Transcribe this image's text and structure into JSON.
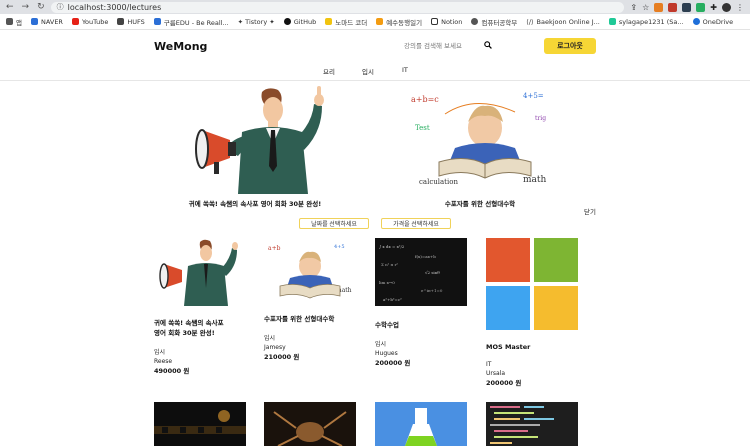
{
  "browser": {
    "url": "localhost:3000/lectures",
    "bookmarks": [
      "앱",
      "NAVER",
      "YouTube",
      "HUFS",
      "구름EDU - Be Reall...",
      "✦ Tistory ✦",
      "GitHub",
      "노마드 코더",
      "예수동행일기",
      "Notion",
      "컴퓨터공학부",
      "Baekjoon Online J...",
      "sylagape1231 (Sa...",
      "OneDrive"
    ]
  },
  "header": {
    "logo": "WeMong",
    "search_placeholder": "강의를 검색해 보세요",
    "logout_label": "로그아웃"
  },
  "categories": [
    "요리",
    "입시",
    "IT"
  ],
  "banner": {
    "slides": [
      {
        "caption": "귀에 쏙쏙! 속쌤의 속사포 영어 회화 30분 완성!"
      },
      {
        "caption": "수포자를 위한 선형대수학"
      }
    ],
    "close_label": "닫기"
  },
  "filters": {
    "date_label": "날짜를 선택하세요",
    "price_label": "가격을 선택하세요"
  },
  "lectures": [
    {
      "title_line1": "귀에 쏙쏙! 속쌤의 속사포",
      "title_line2": "영어 회화 30분 완성!",
      "category": "입시",
      "teacher": "Reese",
      "price": "490000 원"
    },
    {
      "title_line1": "수포자를 위한 선형대수학",
      "title_line2": "",
      "category": "입시",
      "teacher": "Jamesy",
      "price": "210000 원"
    },
    {
      "title_line1": "수학수업",
      "title_line2": "",
      "category": "입시",
      "teacher": "Hugues",
      "price": "200000 원"
    },
    {
      "title_line1": "MOS Master",
      "title_line2": "",
      "category": "IT",
      "teacher": "Ursala",
      "price": "200000 원"
    }
  ],
  "colors": {
    "accent_yellow": "#f6d635",
    "ms_red": "#e2572e",
    "ms_green": "#7eb533",
    "ms_blue": "#3ea4f0",
    "ms_yellow": "#f5bc2e"
  }
}
